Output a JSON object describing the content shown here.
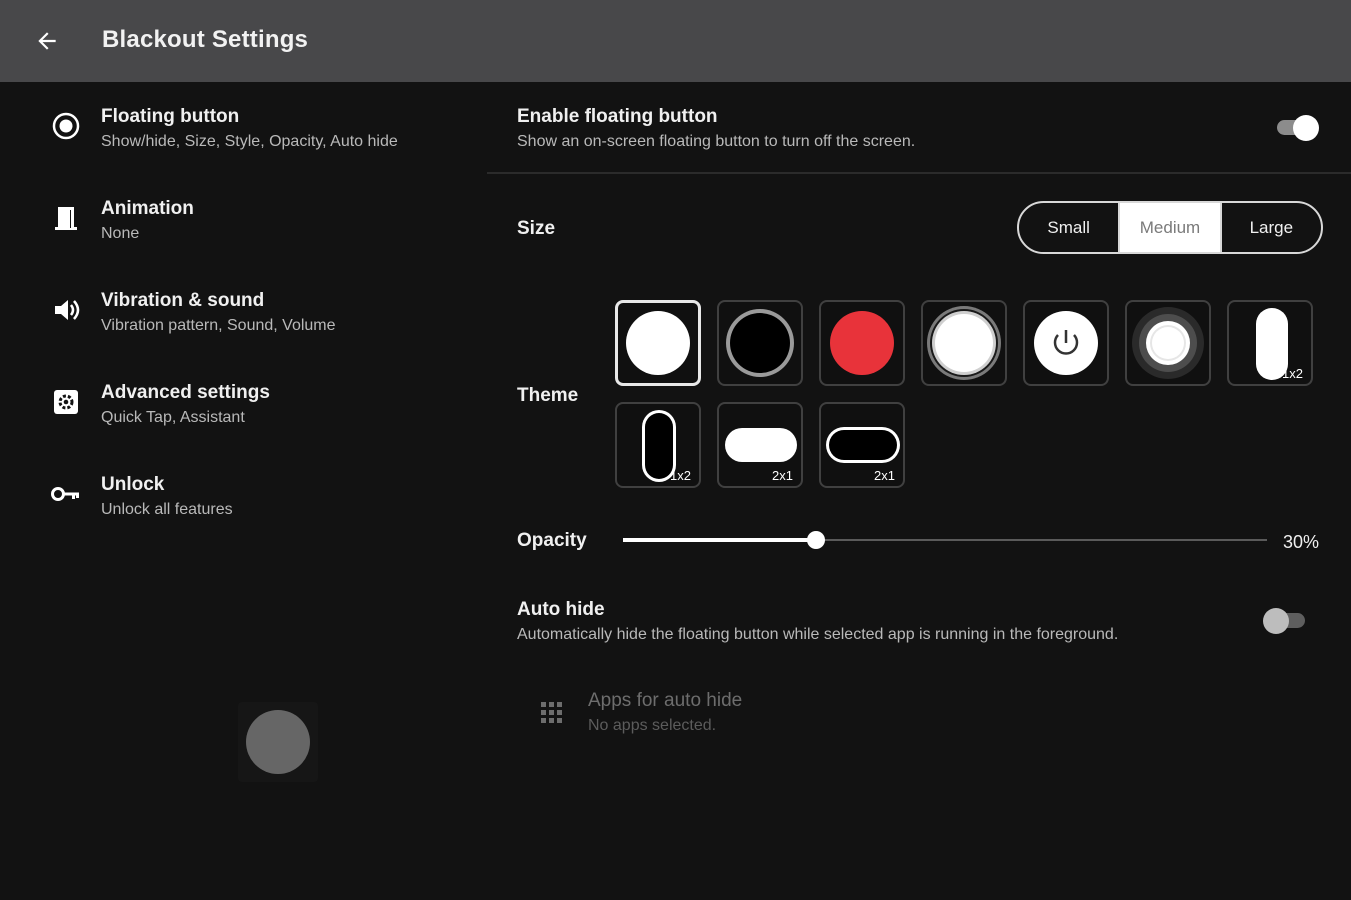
{
  "appbar": {
    "title": "Blackout Settings",
    "back_icon": "arrow-left-icon"
  },
  "nav": {
    "items": [
      {
        "title": "Floating button",
        "subtitle": "Show/hide, Size, Style, Opacity, Auto hide",
        "icon": "radio-target-icon"
      },
      {
        "title": "Animation",
        "subtitle": "None",
        "icon": "door-icon"
      },
      {
        "title": "Vibration & sound",
        "subtitle": "Vibration pattern, Sound, Volume",
        "icon": "speaker-icon"
      },
      {
        "title": "Advanced settings",
        "subtitle": "Quick Tap, Assistant",
        "icon": "settings-box-icon"
      },
      {
        "title": "Unlock",
        "subtitle": "Unlock all features",
        "icon": "key-icon"
      }
    ],
    "preview_color": "#666666"
  },
  "panel": {
    "enable": {
      "title": "Enable floating button",
      "subtitle": "Show an on-screen floating button to turn off the screen.",
      "on": true
    },
    "size": {
      "label": "Size",
      "options": [
        "Small",
        "Medium",
        "Large"
      ],
      "selected": "Medium"
    },
    "theme": {
      "label": "Theme",
      "tiles": [
        {
          "style": "white-circle",
          "badge": ""
        },
        {
          "style": "black-circle-grey-ring",
          "badge": ""
        },
        {
          "style": "red-circle",
          "badge": ""
        },
        {
          "style": "white-circle-double-ring",
          "badge": ""
        },
        {
          "style": "white-power-circle",
          "badge": ""
        },
        {
          "style": "glow-ring-circle",
          "badge": ""
        },
        {
          "style": "white-pill-vertical",
          "badge": "1x2"
        },
        {
          "style": "black-pill-vertical",
          "badge": "1x2"
        },
        {
          "style": "white-pill-horizontal",
          "badge": "2x1"
        },
        {
          "style": "black-pill-horizontal",
          "badge": "2x1"
        }
      ],
      "selected_index": 0,
      "accent_red": "#e8333a"
    },
    "opacity": {
      "label": "Opacity",
      "value_text": "30%",
      "value": 0.3
    },
    "autohide": {
      "title": "Auto hide",
      "subtitle": "Automatically hide the floating button while selected app is running in the foreground.",
      "on": false
    },
    "apps": {
      "title": "Apps for auto hide",
      "subtitle": "No apps selected.",
      "icon": "apps-grid-icon"
    }
  }
}
